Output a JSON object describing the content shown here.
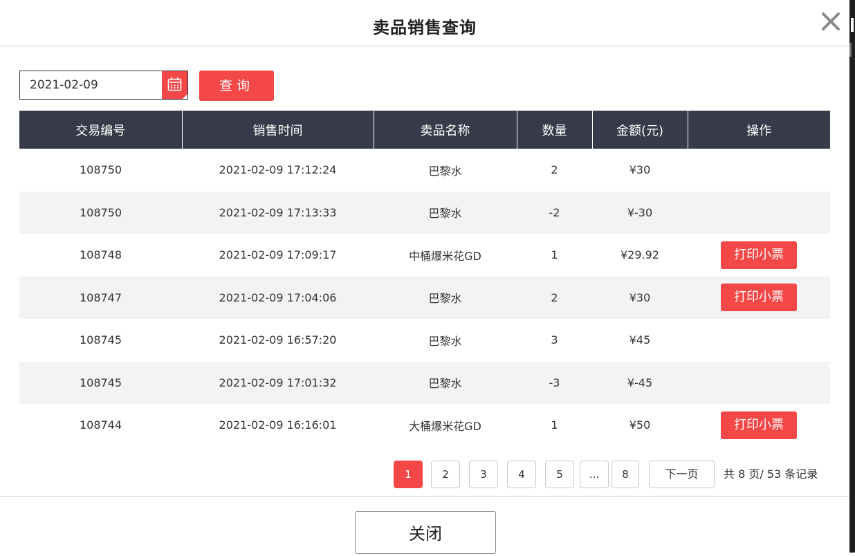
{
  "dialog": {
    "title": "卖品销售查询",
    "close_icon": "close-icon"
  },
  "filter": {
    "date_value": "2021-02-09",
    "calendar_icon": "calendar-icon",
    "query_label": "查询"
  },
  "table": {
    "headers": [
      "交易编号",
      "销售时间",
      "卖品名称",
      "数量",
      "金额(元)",
      "操作"
    ],
    "rows": [
      {
        "id": "108750",
        "time": "2021-02-09 17:12:24",
        "name": "巴黎水",
        "qty": "2",
        "amount": "¥30",
        "action": ""
      },
      {
        "id": "108750",
        "time": "2021-02-09 17:13:33",
        "name": "巴黎水",
        "qty": "-2",
        "amount": "¥-30",
        "action": ""
      },
      {
        "id": "108748",
        "time": "2021-02-09 17:09:17",
        "name": "中桶爆米花GD",
        "qty": "1",
        "amount": "¥29.92",
        "action": "打印小票"
      },
      {
        "id": "108747",
        "time": "2021-02-09 17:04:06",
        "name": "巴黎水",
        "qty": "2",
        "amount": "¥30",
        "action": "打印小票"
      },
      {
        "id": "108745",
        "time": "2021-02-09 16:57:20",
        "name": "巴黎水",
        "qty": "3",
        "amount": "¥45",
        "action": ""
      },
      {
        "id": "108745",
        "time": "2021-02-09 17:01:32",
        "name": "巴黎水",
        "qty": "-3",
        "amount": "¥-45",
        "action": ""
      },
      {
        "id": "108744",
        "time": "2021-02-09 16:16:01",
        "name": "大桶爆米花GD",
        "qty": "1",
        "amount": "¥50",
        "action": "打印小票"
      }
    ]
  },
  "pagination": {
    "pages": [
      "1",
      "2",
      "3",
      "4",
      "5",
      "...",
      "8"
    ],
    "current": "1",
    "next_label": "下一页",
    "total_text": "共 8 页/ 53 条记录"
  },
  "footer": {
    "close_label": "关闭"
  },
  "colors": {
    "accent": "#f44747",
    "header_bg": "#373a48",
    "row_alt": "#f3f3f5"
  }
}
